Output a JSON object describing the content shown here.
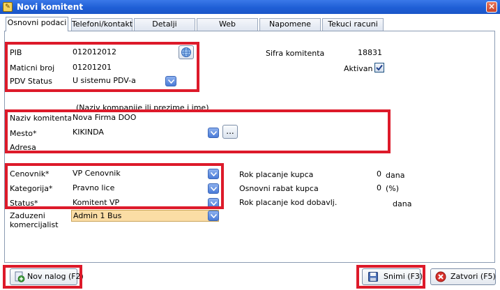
{
  "window": {
    "title": "Novi komitent",
    "close_glyph": "×"
  },
  "tabs": [
    {
      "label": "Osnovni podaci",
      "active": true
    },
    {
      "label": "Telefoni/kontakt",
      "active": false
    },
    {
      "label": "Detalji",
      "active": false
    },
    {
      "label": "Web",
      "active": false
    },
    {
      "label": "Napomene",
      "active": false
    },
    {
      "label": "Tekuci racuni",
      "active": false
    }
  ],
  "basic": {
    "pib_label": "PIB",
    "pib_value": "012012012",
    "maticni_label": "Maticni broj",
    "maticni_value": "01201201",
    "pdv_label": "PDV Status",
    "pdv_value": "U sistemu PDV-a"
  },
  "sifra": {
    "label": "Sifra komitenta",
    "value": "18831",
    "aktivan_label": "Aktivan",
    "aktivan_checked": true
  },
  "naziv": {
    "hint": "(Naziv kompanije ili prezime i ime)",
    "label": "Naziv komitenta",
    "value": "Nova Firma DOO",
    "mesto_label": "Mesto*",
    "mesto_value": "KIKINDA",
    "mesto_button_label": "...",
    "adresa_label": "Adresa",
    "adresa_value": ""
  },
  "classification": {
    "cenovnik_label": "Cenovnik*",
    "cenovnik_value": "VP Cenovnik",
    "kategorija_label": "Kategorija*",
    "kategorija_value": "Pravno lice",
    "status_label": "Status*",
    "status_value": "Komitent VP",
    "zaduzeni_label_1": "Zaduzeni",
    "zaduzeni_label_2": "komercijalist",
    "zaduzeni_value": "Admin 1 Bus"
  },
  "terms": {
    "rok_kupca_label": "Rok placanje kupca",
    "rok_kupca_value": "0",
    "rok_kupca_unit": "dana",
    "rabat_label": "Osnovni rabat kupca",
    "rabat_value": "0",
    "rabat_unit": "(%)",
    "rok_dob_label": "Rok placanje kod dobavlj.",
    "rok_dob_value": "",
    "rok_dob_unit": "dana"
  },
  "footer": {
    "nov_nalog_label": "Nov nalog (F2)",
    "snimi_label": "Snimi (F3)",
    "zatvori_label": "Zatvori (F5)"
  },
  "colors": {
    "highlight": "#dd1a2a",
    "titlebar": "#1f5fd6",
    "selected_field": "#fbdda5"
  }
}
